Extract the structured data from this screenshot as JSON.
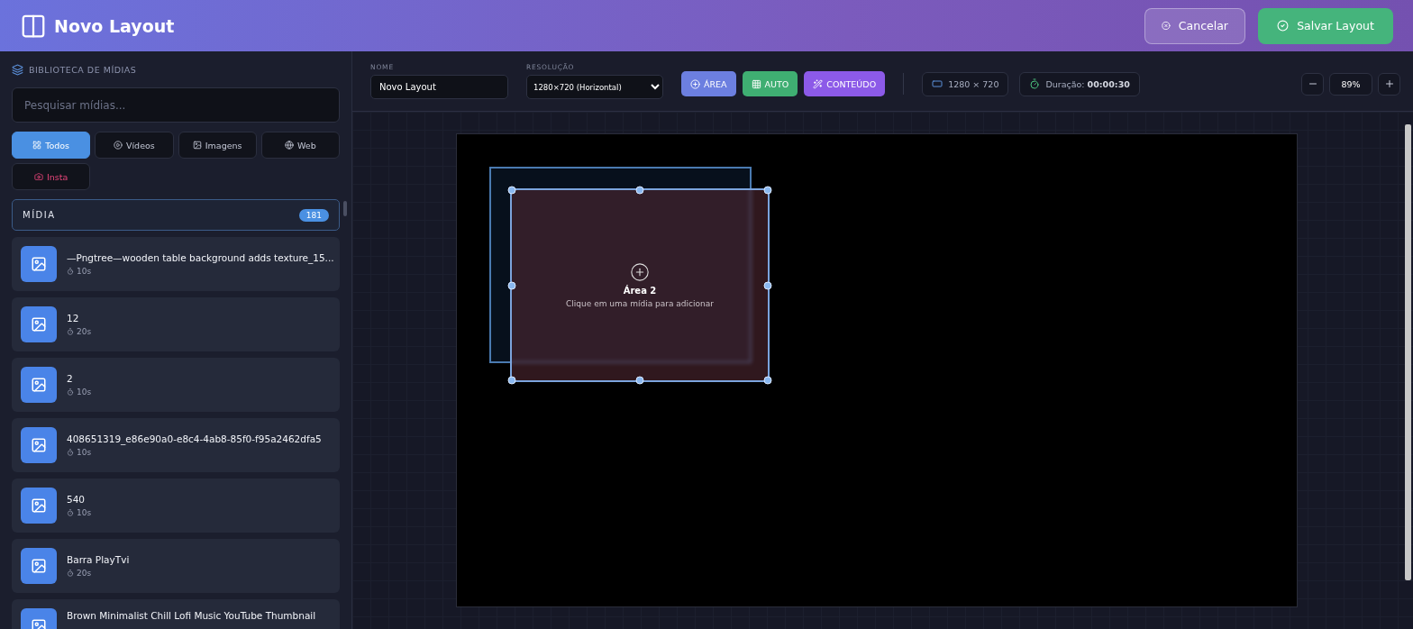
{
  "header": {
    "title": "Novo Layout",
    "buttons": [
      {
        "label": "Cancelar",
        "kind": "cancel"
      },
      {
        "label": "Salvar Layout",
        "kind": "save"
      }
    ]
  },
  "library": {
    "title": "BIBLIOTECA DE MÍDIAS",
    "search": {
      "placeholder": "Pesquisar mídias..."
    },
    "filters": [
      {
        "label": "Todos",
        "kind": "all",
        "selected": true
      },
      {
        "label": "Vídeos",
        "kind": "video",
        "selected": false
      },
      {
        "label": "Imagens",
        "kind": "image",
        "selected": false
      },
      {
        "label": "Web",
        "kind": "web",
        "selected": false
      },
      {
        "label": "Insta",
        "kind": "insta",
        "selected": false
      }
    ],
    "section": {
      "title": "MÍDIA",
      "count": "181"
    },
    "items": [
      {
        "name": "—Pngtree—wooden table background adds texture_15...",
        "duration": "10s"
      },
      {
        "name": "12",
        "duration": "20s"
      },
      {
        "name": "2",
        "duration": "10s"
      },
      {
        "name": "408651319_e86e90a0-e8c4-4ab8-85f0-f95a2462dfa5",
        "duration": "10s"
      },
      {
        "name": "540",
        "duration": "10s"
      },
      {
        "name": "Barra PlayTvi",
        "duration": "20s"
      },
      {
        "name": "Brown Minimalist Chill Lofi Music YouTube Thumbnail"
      }
    ]
  },
  "toolbar": {
    "name_field": {
      "label": "NOME",
      "value": "Novo Layout"
    },
    "resolution_field": {
      "label": "RESOLUÇÃO",
      "value": "1280×720 (Horizontal)"
    },
    "actions": [
      {
        "label": "ÁREA",
        "kind": "area"
      },
      {
        "label": "AUTO",
        "kind": "auto"
      },
      {
        "label": "CONTEÚDO",
        "kind": "content"
      }
    ],
    "size": "1280 × 720",
    "duration": {
      "label": "Duração:",
      "value": "00:00:30"
    },
    "zoom": "89%"
  },
  "canvas": {
    "areas": [
      {
        "selected": false
      },
      {
        "title": "Área 2",
        "hint": "Clique em uma mídia para adicionar",
        "selected": true
      }
    ]
  }
}
